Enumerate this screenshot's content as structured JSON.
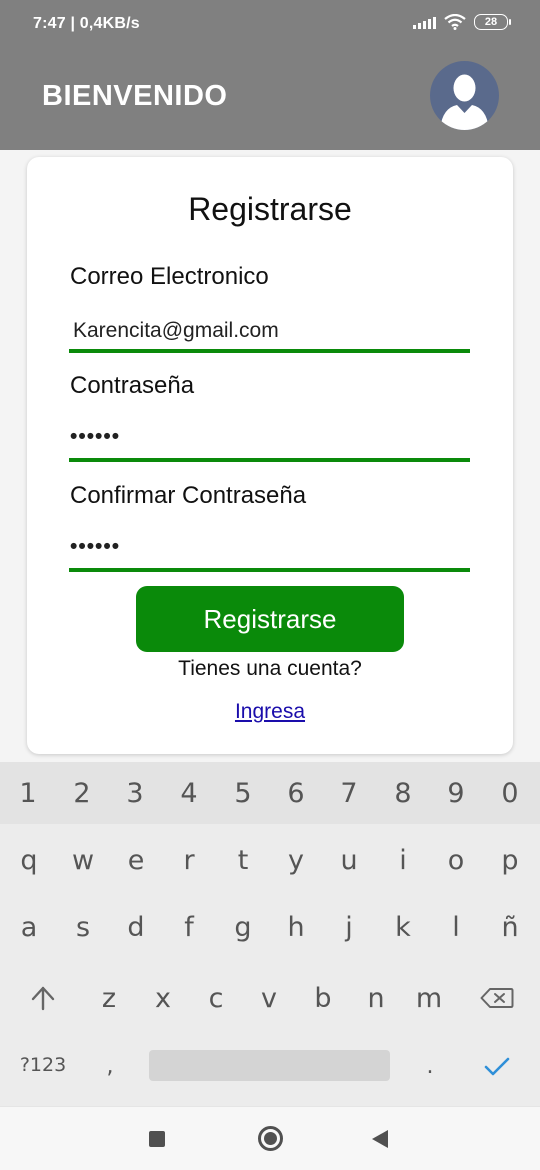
{
  "status_bar": {
    "time_text": "7:47 | 0,4KB/s",
    "battery": "28"
  },
  "app_bar": {
    "title": "BIENVENIDO",
    "avatar_icon": "user-avatar-icon"
  },
  "form": {
    "title": "Registrarse",
    "email": {
      "label": "Correo Electronico",
      "value": "Karencita@gmail.com"
    },
    "password": {
      "label": "Contraseña",
      "value": "••••••"
    },
    "confirm_password": {
      "label": "Confirmar Contraseña",
      "value": "••••••"
    },
    "submit_label": "Registrarse",
    "has_account_text": "Tienes una cuenta?",
    "login_link": "Ingresa",
    "accent_color": "#0a8a0a"
  },
  "keyboard": {
    "number_row": [
      "1",
      "2",
      "3",
      "4",
      "5",
      "6",
      "7",
      "8",
      "9",
      "0"
    ],
    "row1": [
      "q",
      "w",
      "e",
      "r",
      "t",
      "y",
      "u",
      "i",
      "o",
      "p"
    ],
    "row2": [
      "a",
      "s",
      "d",
      "f",
      "g",
      "h",
      "j",
      "k",
      "l",
      "ñ"
    ],
    "row3": [
      "z",
      "x",
      "c",
      "v",
      "b",
      "n",
      "m"
    ],
    "symbols_label": "?123",
    "comma": ",",
    "period": ".",
    "shift_icon": "shift-arrow-icon",
    "backspace_icon": "backspace-icon",
    "enter_icon": "checkmark-icon"
  },
  "nav_bar": {
    "icons": [
      "recents-square-icon",
      "home-circle-icon",
      "back-triangle-icon"
    ]
  }
}
